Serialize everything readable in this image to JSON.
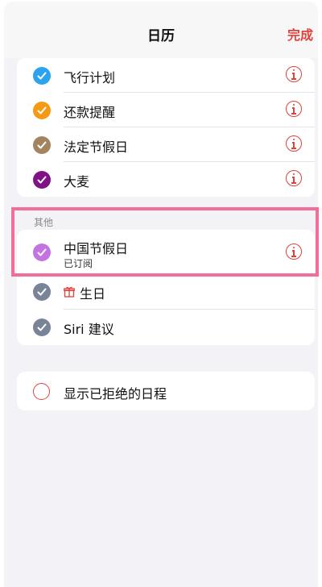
{
  "header": {
    "title": "日历",
    "done_label": "完成"
  },
  "colors": {
    "accent": "#e0413a",
    "highlight_box": "#f06e98",
    "flight": "#2ba3f0",
    "repay": "#f59b13",
    "holiday": "#a2845e",
    "damai": "#7f1285",
    "china_holiday": "#c374e1",
    "other_gray": "#7a8499"
  },
  "calendars_top": [
    {
      "label": "飞行计划",
      "icon": "checkmark-icon"
    },
    {
      "label": "还款提醒",
      "icon": "checkmark-icon"
    },
    {
      "label": "法定节假日",
      "icon": "checkmark-icon"
    },
    {
      "label": "大麦",
      "icon": "checkmark-icon"
    }
  ],
  "other_section": {
    "label": "其他",
    "items": [
      {
        "label": "中国节假日",
        "subtitle": "已订阅",
        "icon": "checkmark-icon"
      },
      {
        "label": "生日",
        "icon": "gift-icon"
      },
      {
        "label": "Siri 建议",
        "icon": "checkmark-icon"
      }
    ]
  },
  "declined": {
    "label": "显示已拒绝的日程"
  }
}
